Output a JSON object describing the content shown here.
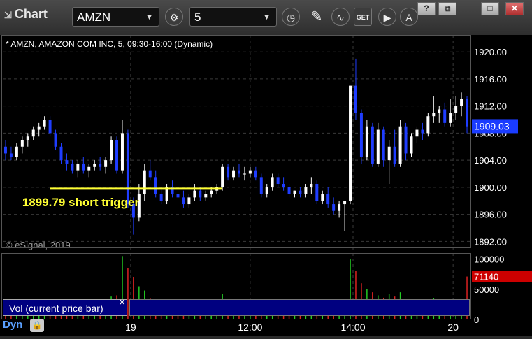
{
  "window": {
    "title": "Chart",
    "symbol": "AMZN",
    "interval": "5",
    "toolbar_icons": [
      "settings-icon",
      "clock-icon",
      "pencil-icon",
      "study-icon",
      "get-icon",
      "play-icon",
      "alert-icon"
    ],
    "window_buttons": [
      "?",
      "⧉",
      "□",
      "✕"
    ]
  },
  "chart_header": "* AMZN, AMAZON COM INC, 5, 09:30-16:00 (Dynamic)",
  "watermark": "© eSignal, 2019",
  "annotation": {
    "text": "1899.79 short trigger",
    "price": 1899.79,
    "color": "#ffff33"
  },
  "study_label": "Vol (current price bar)",
  "footer": {
    "mode": "Dyn"
  },
  "chart_data": {
    "type": "candlestick",
    "title": "AMZN, AMAZON COM INC, 5, 09:30-16:00 (Dynamic)",
    "y_ticks": [
      "1920.00",
      "1916.00",
      "1912.00",
      "1908.00",
      "1904.00",
      "1900.00",
      "1896.00",
      "1892.00"
    ],
    "ylim": [
      1891,
      1922.5
    ],
    "last_price": "1909.03",
    "x_ticks": [
      {
        "label": "19",
        "bar": 22.5
      },
      {
        "label": "12:00",
        "bar": 44
      },
      {
        "label": "14:00",
        "bar": 62.5
      },
      {
        "label": "20",
        "bar": 80.5
      }
    ],
    "vol_ticks": [
      "100000",
      "50000",
      "0"
    ],
    "vol_max": 110000,
    "last_volume": "71140",
    "bars": [
      [
        1906.0,
        1907.0,
        1904.0,
        1905.0,
        20000
      ],
      [
        1905.0,
        1906.0,
        1904.0,
        1904.5,
        18000
      ],
      [
        1904.5,
        1906.5,
        1904.0,
        1906.0,
        22000
      ],
      [
        1906.0,
        1907.5,
        1905.0,
        1907.0,
        19000
      ],
      [
        1907.0,
        1908.0,
        1906.0,
        1907.5,
        15000
      ],
      [
        1907.5,
        1909.0,
        1907.0,
        1908.5,
        17000
      ],
      [
        1908.5,
        1909.5,
        1907.5,
        1909.0,
        16000
      ],
      [
        1909.0,
        1910.5,
        1908.5,
        1910.0,
        21000
      ],
      [
        1910.0,
        1910.5,
        1907.5,
        1908.0,
        24000
      ],
      [
        1908.0,
        1908.5,
        1905.5,
        1906.0,
        26000
      ],
      [
        1906.0,
        1906.5,
        1903.5,
        1904.0,
        30000
      ],
      [
        1904.0,
        1905.0,
        1902.5,
        1903.5,
        25000
      ],
      [
        1903.5,
        1904.0,
        1902.0,
        1902.5,
        22000
      ],
      [
        1902.5,
        1904.0,
        1901.5,
        1903.5,
        18000
      ],
      [
        1903.5,
        1904.5,
        1902.0,
        1902.5,
        20000
      ],
      [
        1902.5,
        1903.5,
        1901.5,
        1903.0,
        16000
      ],
      [
        1903.0,
        1904.0,
        1902.5,
        1903.5,
        14000
      ],
      [
        1903.5,
        1904.5,
        1902.5,
        1903.0,
        15000
      ],
      [
        1903.0,
        1904.5,
        1902.0,
        1904.0,
        17000
      ],
      [
        1904.0,
        1907.5,
        1903.5,
        1907.0,
        38000
      ],
      [
        1907.0,
        1907.5,
        1902.0,
        1902.5,
        40000
      ],
      [
        1902.5,
        1910.0,
        1902.0,
        1908.0,
        105000
      ],
      [
        1908.0,
        1908.5,
        1897.0,
        1897.5,
        85000
      ],
      [
        1897.5,
        1898.5,
        1893.0,
        1895.5,
        70000
      ],
      [
        1895.5,
        1900.5,
        1895.0,
        1899.0,
        55000
      ],
      [
        1899.0,
        1903.5,
        1898.0,
        1902.5,
        48000
      ],
      [
        1902.5,
        1904.0,
        1901.0,
        1901.5,
        35000
      ],
      [
        1901.5,
        1902.5,
        1898.5,
        1899.0,
        30000
      ],
      [
        1899.0,
        1900.0,
        1897.5,
        1898.0,
        26000
      ],
      [
        1898.0,
        1900.5,
        1897.5,
        1900.0,
        22000
      ],
      [
        1900.0,
        1901.0,
        1898.5,
        1899.0,
        20000
      ],
      [
        1899.0,
        1900.0,
        1897.5,
        1898.5,
        18000
      ],
      [
        1898.5,
        1899.5,
        1897.0,
        1897.5,
        17000
      ],
      [
        1897.5,
        1899.0,
        1897.0,
        1898.5,
        19000
      ],
      [
        1898.5,
        1900.5,
        1898.0,
        1899.5,
        21000
      ],
      [
        1899.5,
        1900.0,
        1898.0,
        1898.5,
        16000
      ],
      [
        1898.5,
        1899.5,
        1898.0,
        1899.0,
        15000
      ],
      [
        1899.0,
        1900.0,
        1898.5,
        1899.5,
        14000
      ],
      [
        1899.5,
        1900.5,
        1899.0,
        1900.0,
        16000
      ],
      [
        1900.0,
        1903.5,
        1899.5,
        1903.0,
        42000
      ],
      [
        1903.0,
        1903.5,
        1901.0,
        1901.5,
        30000
      ],
      [
        1901.5,
        1903.0,
        1901.0,
        1902.5,
        25000
      ],
      [
        1902.5,
        1903.5,
        1901.5,
        1902.0,
        20000
      ],
      [
        1902.0,
        1903.0,
        1901.0,
        1902.0,
        19000
      ],
      [
        1902.0,
        1903.0,
        1901.5,
        1902.5,
        18000
      ],
      [
        1902.5,
        1903.0,
        1901.0,
        1901.5,
        16000
      ],
      [
        1901.5,
        1902.0,
        1898.5,
        1899.0,
        28000
      ],
      [
        1899.0,
        1900.5,
        1898.5,
        1900.0,
        25000
      ],
      [
        1900.0,
        1902.0,
        1899.5,
        1901.5,
        22000
      ],
      [
        1901.5,
        1902.0,
        1900.0,
        1900.5,
        18000
      ],
      [
        1900.5,
        1901.5,
        1899.5,
        1900.0,
        20000
      ],
      [
        1900.0,
        1900.5,
        1898.5,
        1899.0,
        24000
      ],
      [
        1899.0,
        1899.5,
        1898.5,
        1899.5,
        15000
      ],
      [
        1899.5,
        1900.0,
        1898.5,
        1899.0,
        14000
      ],
      [
        1899.0,
        1900.5,
        1898.5,
        1900.0,
        17000
      ],
      [
        1900.0,
        1901.5,
        1899.0,
        1900.5,
        19000
      ],
      [
        1900.5,
        1901.0,
        1897.5,
        1898.0,
        26000
      ],
      [
        1898.0,
        1899.5,
        1897.5,
        1899.0,
        21000
      ],
      [
        1899.0,
        1900.0,
        1897.0,
        1897.5,
        22000
      ],
      [
        1897.5,
        1898.5,
        1896.0,
        1896.5,
        25000
      ],
      [
        1896.5,
        1898.0,
        1895.5,
        1897.5,
        27000
      ],
      [
        1897.5,
        1898.0,
        1893.5,
        1898.0,
        30000
      ],
      [
        1898.0,
        1915.0,
        1897.5,
        1915.0,
        100000
      ],
      [
        1915.0,
        1919.0,
        1910.0,
        1911.0,
        80000
      ],
      [
        1911.0,
        1911.5,
        1903.5,
        1904.5,
        60000
      ],
      [
        1904.5,
        1910.0,
        1904.0,
        1909.0,
        50000
      ],
      [
        1909.0,
        1909.5,
        1903.0,
        1903.5,
        45000
      ],
      [
        1903.5,
        1909.5,
        1903.0,
        1908.5,
        40000
      ],
      [
        1908.5,
        1909.0,
        1903.0,
        1904.0,
        36000
      ],
      [
        1904.0,
        1907.0,
        1900.5,
        1906.0,
        42000
      ],
      [
        1906.0,
        1908.5,
        1903.0,
        1903.5,
        38000
      ],
      [
        1903.5,
        1910.0,
        1903.0,
        1909.0,
        45000
      ],
      [
        1909.0,
        1909.5,
        1904.0,
        1905.0,
        30000
      ],
      [
        1905.0,
        1908.0,
        1904.5,
        1907.5,
        28000
      ],
      [
        1907.5,
        1909.0,
        1906.5,
        1908.5,
        26000
      ],
      [
        1908.5,
        1909.5,
        1907.0,
        1908.0,
        22000
      ],
      [
        1908.0,
        1911.0,
        1907.5,
        1910.5,
        30000
      ],
      [
        1910.5,
        1913.5,
        1909.5,
        1911.0,
        35000
      ],
      [
        1911.0,
        1912.0,
        1909.5,
        1911.5,
        28000
      ],
      [
        1911.5,
        1912.5,
        1909.0,
        1909.5,
        24000
      ],
      [
        1909.5,
        1913.0,
        1909.0,
        1911.0,
        30000
      ],
      [
        1911.0,
        1913.5,
        1910.0,
        1912.0,
        27000
      ],
      [
        1912.0,
        1914.0,
        1910.5,
        1913.0,
        33000
      ],
      [
        1913.0,
        1913.5,
        1908.0,
        1909.0,
        71140
      ]
    ]
  }
}
